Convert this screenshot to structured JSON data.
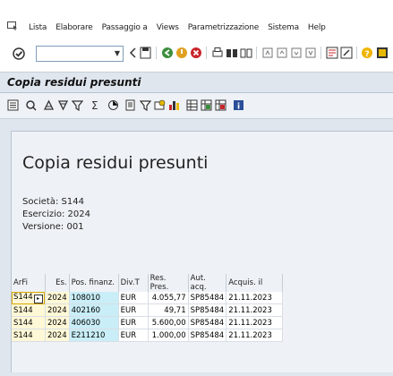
{
  "menu": {
    "items": [
      "Lista",
      "Elaborare",
      "Passaggio a",
      "Views",
      "Parametrizzazione",
      "Sistema",
      "Help"
    ]
  },
  "toolbar": {
    "command_value": ""
  },
  "screen": {
    "title": "Copia residui presunti"
  },
  "header": {
    "title": "Copia residui presunti",
    "societa": "Società: S144",
    "esercizio": "Esercizio: 2024",
    "versione": "Versione: 001"
  },
  "table": {
    "columns": [
      "ArFi",
      "Es.",
      "Pos. finanz.",
      "Div.T",
      "Res. Pres.",
      "Aut. acq.",
      "Acquis. il"
    ],
    "rows": [
      [
        "S144",
        "2024",
        "108010",
        "EUR",
        "4.055,77",
        "SP85484",
        "21.11.2023"
      ],
      [
        "S144",
        "2024",
        "402160",
        "EUR",
        "49,71",
        "SP85484",
        "21.11.2023"
      ],
      [
        "S144",
        "2024",
        "406030",
        "EUR",
        "5.600,00",
        "SP85484",
        "21.11.2023"
      ],
      [
        "S144",
        "2024",
        "E211210",
        "EUR",
        "1.000,00",
        "SP85484",
        "21.11.2023"
      ]
    ]
  },
  "colors": {
    "key_cell": "#fff8d6",
    "cyan_cell": "#c9eef7",
    "background": "#dfe6ee"
  }
}
